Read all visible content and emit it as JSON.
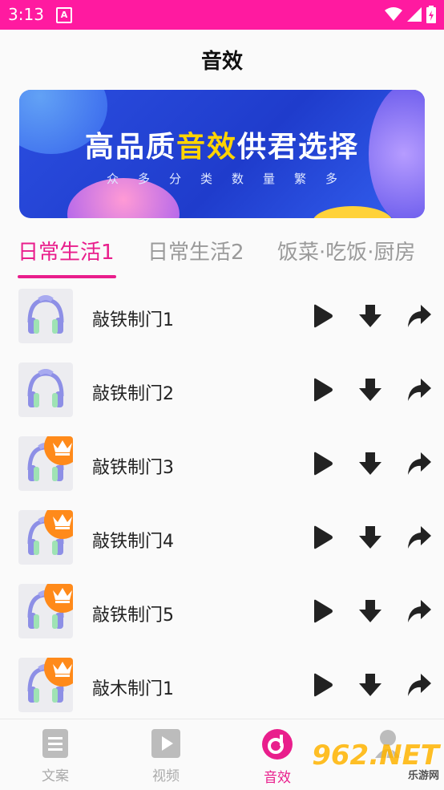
{
  "status": {
    "time": "3:13",
    "notif_letter": "A"
  },
  "page_title": "音效",
  "banner": {
    "headline_a": "高品质",
    "headline_b": "音效",
    "headline_c": "供君选择",
    "sub": "众多分类数量繁多",
    "colors": {
      "bg": "#1f3ccc",
      "highlight": "#ffd400"
    }
  },
  "tabs": [
    {
      "label": "日常生活1",
      "active": true
    },
    {
      "label": "日常生活2",
      "active": false
    },
    {
      "label": "饭菜·吃饭·厨房",
      "active": false
    }
  ],
  "items": [
    {
      "name": "敲铁制门1",
      "vip": false
    },
    {
      "name": "敲铁制门2",
      "vip": false
    },
    {
      "name": "敲铁制门3",
      "vip": true
    },
    {
      "name": "敲铁制门4",
      "vip": true
    },
    {
      "name": "敲铁制门5",
      "vip": true
    },
    {
      "name": "敲木制门1",
      "vip": true
    }
  ],
  "nav": [
    {
      "label": "文案",
      "icon": "document-icon",
      "active": false
    },
    {
      "label": "视频",
      "icon": "video-icon",
      "active": false
    },
    {
      "label": "音效",
      "icon": "music-disc-icon",
      "active": true
    },
    {
      "label": "",
      "icon": "person-icon",
      "active": false
    }
  ],
  "watermark": {
    "text": "962",
    "suffix": ".NET",
    "sub": "乐游网"
  },
  "accent": "#e91e8c"
}
